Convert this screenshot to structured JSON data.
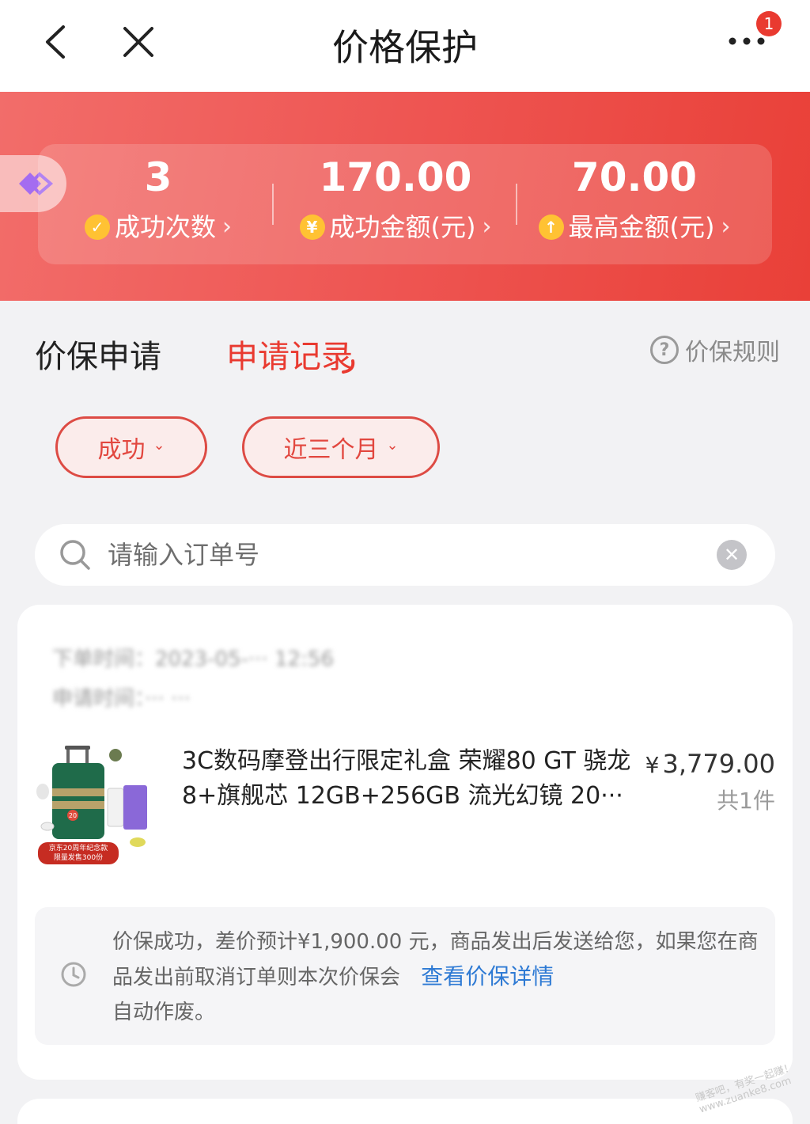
{
  "header": {
    "title": "价格保护",
    "notification_count": "1"
  },
  "stats": {
    "success_count": {
      "value": "3",
      "label": "成功次数",
      "icon_glyph": "✓"
    },
    "success_amount": {
      "value": "170.00",
      "label": "成功金额(元)",
      "icon_glyph": "¥"
    },
    "max_amount": {
      "value": "70.00",
      "label": "最高金额(元)",
      "icon_glyph": "↑"
    }
  },
  "tabs": {
    "apply": "价保申请",
    "records": "申请记录",
    "rules": "价保规则"
  },
  "filters": {
    "status": "成功",
    "range": "近三个月"
  },
  "search": {
    "placeholder": "请输入订单号",
    "value": ""
  },
  "order": {
    "meta_line1": "下单时间：2023-05-··· 12:56",
    "meta_line2": "申请时间：··· ···",
    "product_name": "3C数码摩登出行限定礼盒 荣耀80 GT 骁龙8+旗舰芯 12GB+256GB 流光幻镜 20···",
    "price_symbol": "¥",
    "price": "3,779.00",
    "quantity": "共1件",
    "thumb_tag_line1": "京东20周年纪念款",
    "thumb_tag_line2": "限量发售300份",
    "thumb_badge": "20",
    "notice_text": "价保成功，差价预计¥1,900.00 元，商品发出后发送给您，如果您在商品发出前取消订单则本次价保会",
    "notice_link": "查看价保详情",
    "notice_tail": "自动作废。"
  },
  "watermark": "赚客吧，有奖一起赚！ www.zuanke8.com",
  "colors": {
    "accent": "#e93a30",
    "banner_start": "#f26d6a",
    "banner_end": "#e94038",
    "link": "#2e7ad4",
    "coin": "#ffc233"
  }
}
